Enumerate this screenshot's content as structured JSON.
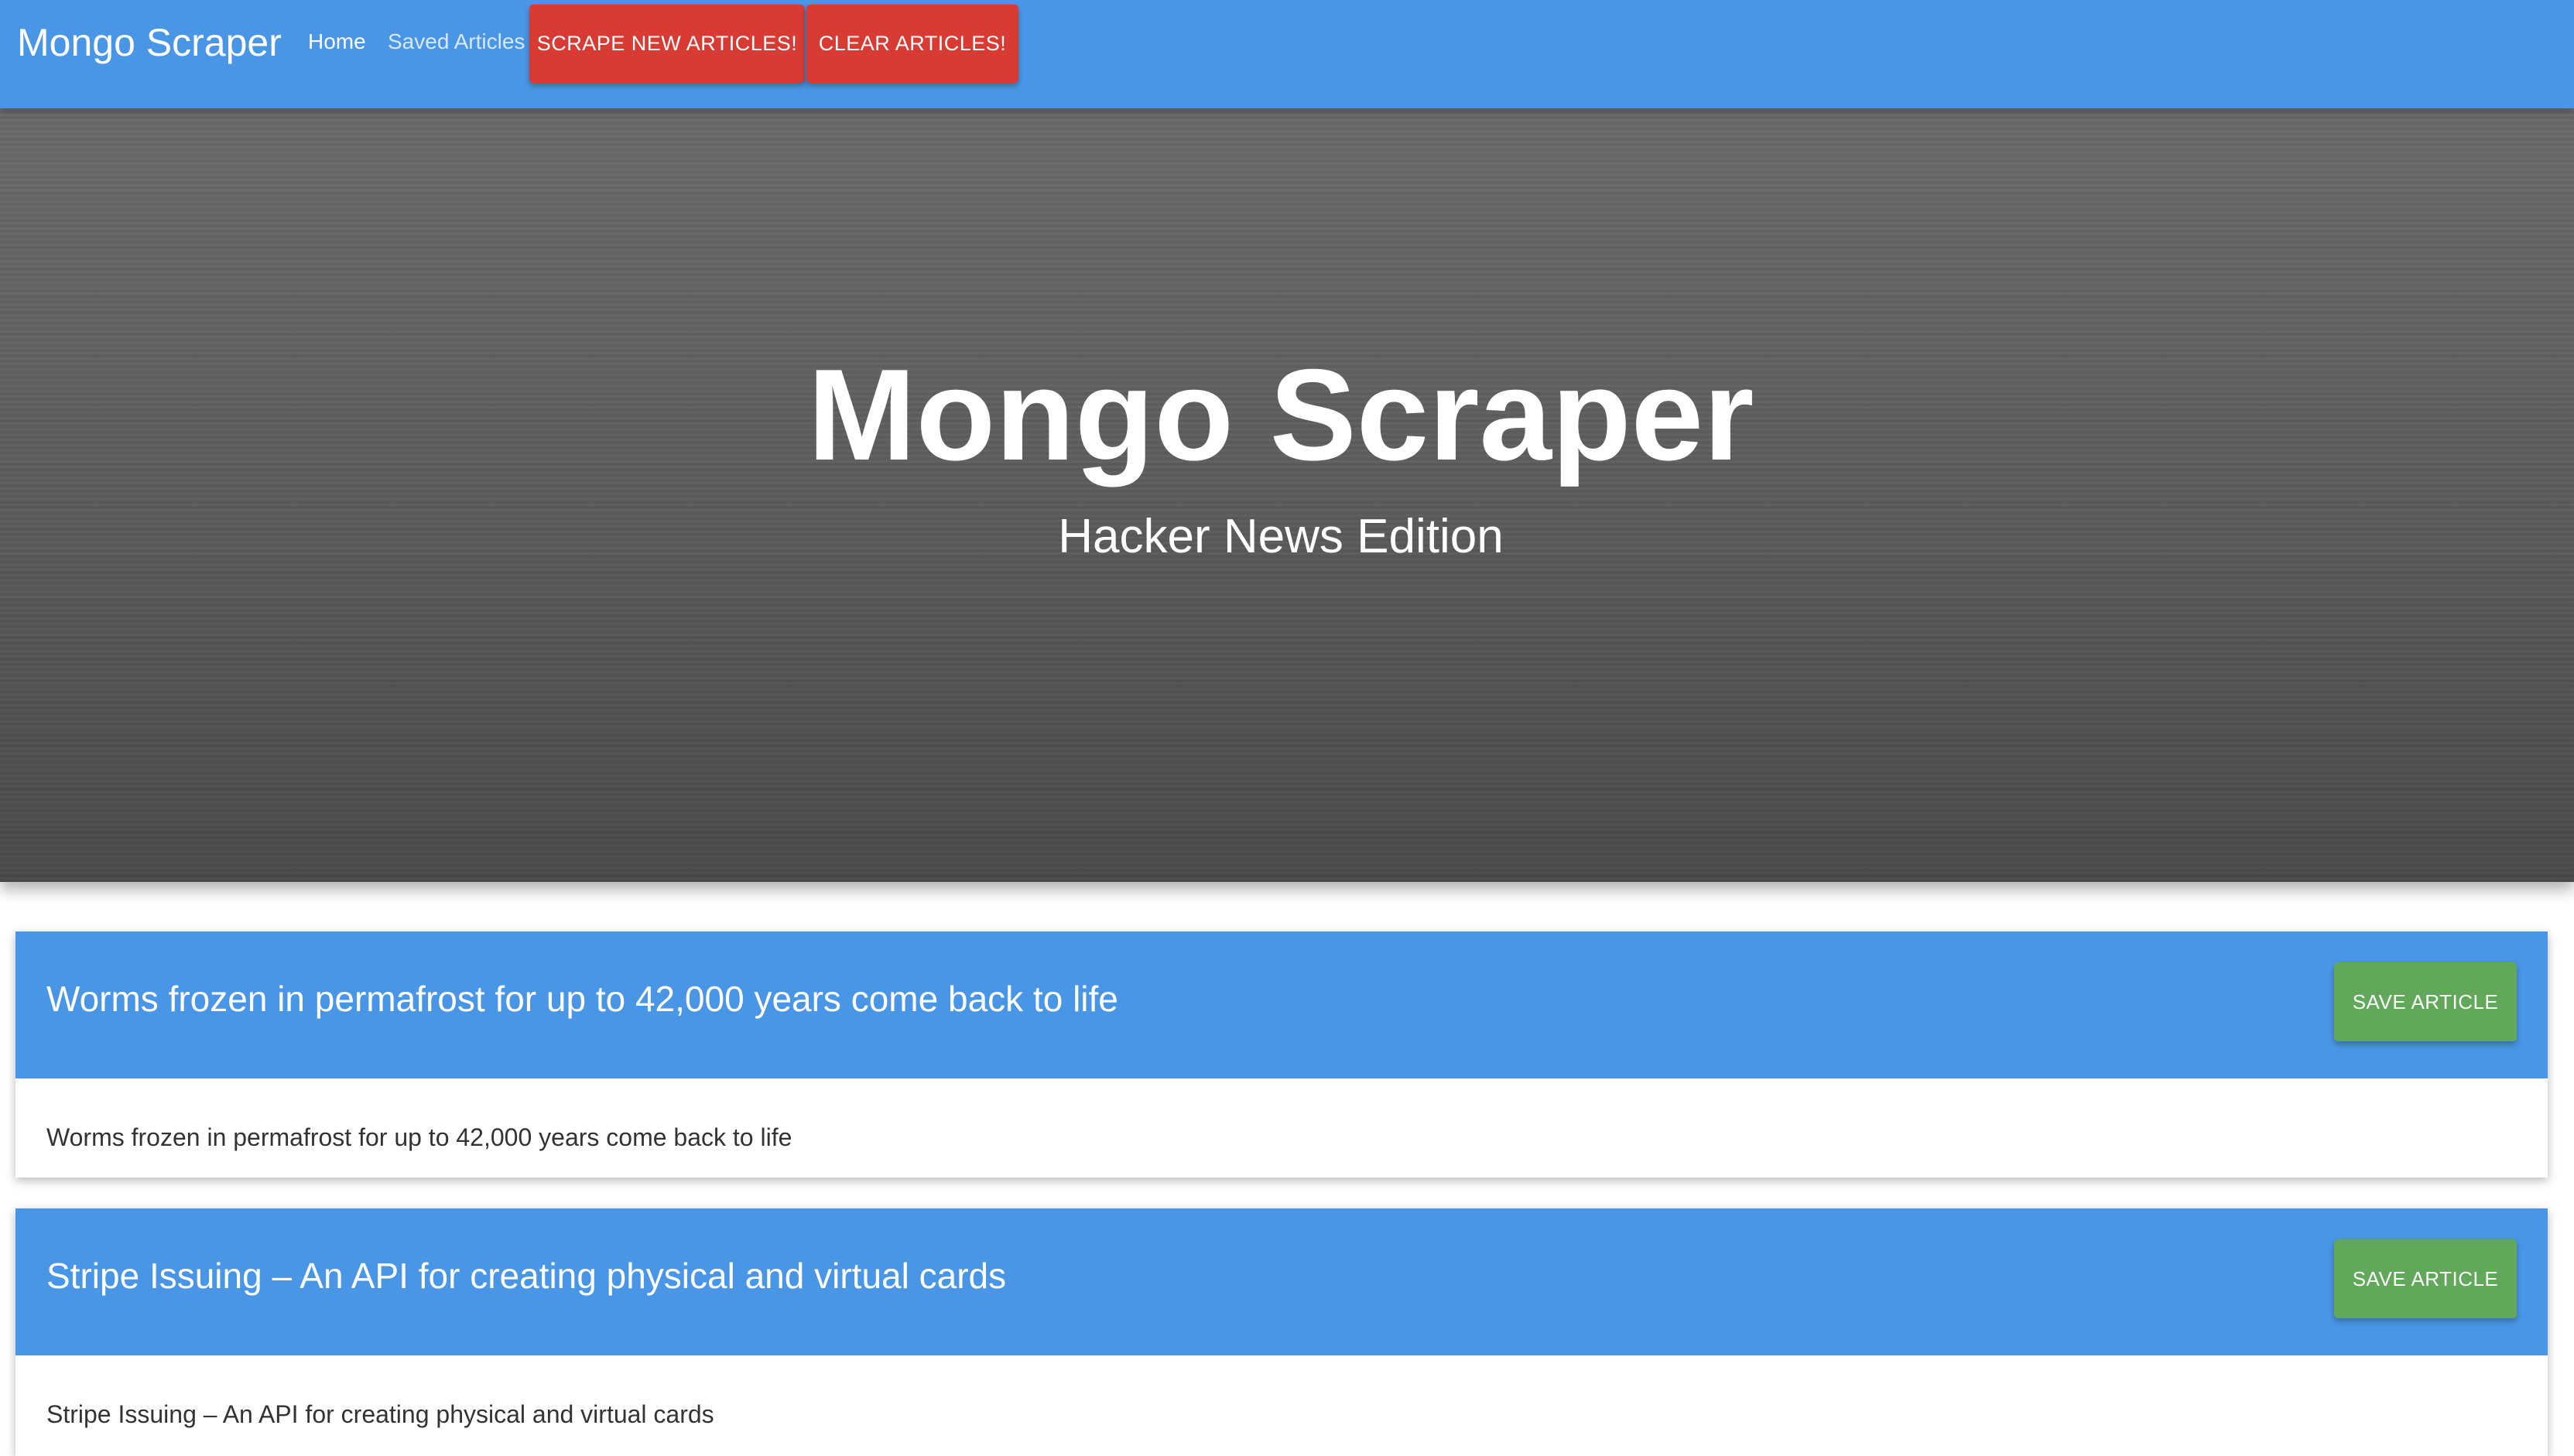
{
  "navbar": {
    "brand": "Mongo Scraper",
    "home_label": "Home",
    "saved_label": "Saved Articles",
    "scrape_label": "SCRAPE NEW ARTICLES!",
    "clear_label": "CLEAR ARTICLES!"
  },
  "hero": {
    "title": "Mongo Scraper",
    "subtitle": "Hacker News Edition"
  },
  "articles": [
    {
      "title": "Worms frozen in permafrost for up to 42,000 years come back to life",
      "summary": "Worms frozen in permafrost for up to 42,000 years come back to life",
      "save_label": "SAVE ARTICLE"
    },
    {
      "title": "Stripe Issuing – An API for creating physical and virtual cards",
      "summary": "Stripe Issuing – An API for creating physical and virtual cards",
      "save_label": "SAVE ARTICLE"
    }
  ],
  "colors": {
    "primary_blue": "#4a96e6",
    "danger_red": "#d73b34",
    "success_green": "#62a85a",
    "hero_gray": "#5e5e5e"
  }
}
